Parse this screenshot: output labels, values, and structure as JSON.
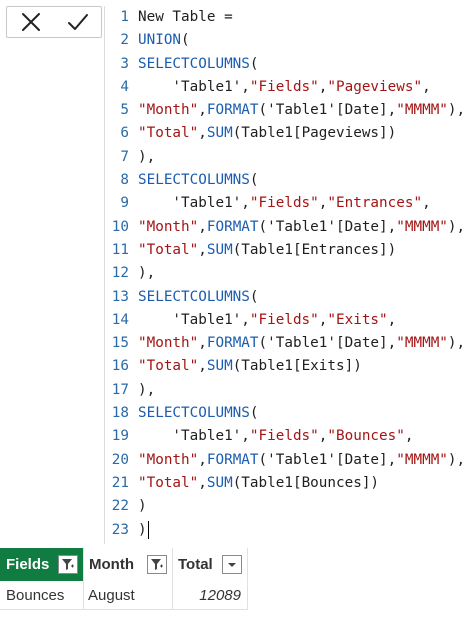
{
  "formula_bar": {
    "cancel_icon": "close-x-icon",
    "commit_icon": "checkmark-icon"
  },
  "editor": {
    "lines": [
      {
        "num": "1",
        "tokens": [
          {
            "t": "New Table = ",
            "c": "p"
          }
        ]
      },
      {
        "num": "2",
        "tokens": [
          {
            "t": "UNION",
            "c": "kw"
          },
          {
            "t": "(",
            "c": "p"
          }
        ]
      },
      {
        "num": "3",
        "tokens": [
          {
            "t": "SELECTCOLUMNS",
            "c": "kw"
          },
          {
            "t": "(",
            "c": "p"
          }
        ]
      },
      {
        "num": "4",
        "tokens": [
          {
            "t": "    'Table1'",
            "c": "p"
          },
          {
            "t": ",",
            "c": "p"
          },
          {
            "t": "\"Fields\"",
            "c": "str"
          },
          {
            "t": ",",
            "c": "p"
          },
          {
            "t": "\"Pageviews\"",
            "c": "str"
          },
          {
            "t": ",",
            "c": "p"
          }
        ]
      },
      {
        "num": "5",
        "tokens": [
          {
            "t": "\"Month\"",
            "c": "str"
          },
          {
            "t": ",",
            "c": "p"
          },
          {
            "t": "FORMAT",
            "c": "kw"
          },
          {
            "t": "('Table1'[Date],",
            "c": "p"
          },
          {
            "t": "\"MMMM\"",
            "c": "str"
          },
          {
            "t": "),",
            "c": "p"
          }
        ]
      },
      {
        "num": "6",
        "tokens": [
          {
            "t": "\"Total\"",
            "c": "str"
          },
          {
            "t": ",",
            "c": "p"
          },
          {
            "t": "SUM",
            "c": "kw"
          },
          {
            "t": "(Table1[Pageviews])",
            "c": "p"
          }
        ]
      },
      {
        "num": "7",
        "tokens": [
          {
            "t": "),",
            "c": "p"
          }
        ]
      },
      {
        "num": "8",
        "tokens": [
          {
            "t": "SELECTCOLUMNS",
            "c": "kw"
          },
          {
            "t": "(",
            "c": "p"
          }
        ]
      },
      {
        "num": "9",
        "tokens": [
          {
            "t": "    'Table1'",
            "c": "p"
          },
          {
            "t": ",",
            "c": "p"
          },
          {
            "t": "\"Fields\"",
            "c": "str"
          },
          {
            "t": ",",
            "c": "p"
          },
          {
            "t": "\"Entrances\"",
            "c": "str"
          },
          {
            "t": ",",
            "c": "p"
          }
        ]
      },
      {
        "num": "10",
        "tokens": [
          {
            "t": "\"Month\"",
            "c": "str"
          },
          {
            "t": ",",
            "c": "p"
          },
          {
            "t": "FORMAT",
            "c": "kw"
          },
          {
            "t": "('Table1'[Date],",
            "c": "p"
          },
          {
            "t": "\"MMMM\"",
            "c": "str"
          },
          {
            "t": "),",
            "c": "p"
          }
        ]
      },
      {
        "num": "11",
        "tokens": [
          {
            "t": "\"Total\"",
            "c": "str"
          },
          {
            "t": ",",
            "c": "p"
          },
          {
            "t": "SUM",
            "c": "kw"
          },
          {
            "t": "(Table1[Entrances])",
            "c": "p"
          }
        ]
      },
      {
        "num": "12",
        "tokens": [
          {
            "t": "),",
            "c": "p"
          }
        ]
      },
      {
        "num": "13",
        "tokens": [
          {
            "t": "SELECTCOLUMNS",
            "c": "kw"
          },
          {
            "t": "(",
            "c": "p"
          }
        ]
      },
      {
        "num": "14",
        "tokens": [
          {
            "t": "    'Table1'",
            "c": "p"
          },
          {
            "t": ",",
            "c": "p"
          },
          {
            "t": "\"Fields\"",
            "c": "str"
          },
          {
            "t": ",",
            "c": "p"
          },
          {
            "t": "\"Exits\"",
            "c": "str"
          },
          {
            "t": ",",
            "c": "p"
          }
        ]
      },
      {
        "num": "15",
        "tokens": [
          {
            "t": "\"Month\"",
            "c": "str"
          },
          {
            "t": ",",
            "c": "p"
          },
          {
            "t": "FORMAT",
            "c": "kw"
          },
          {
            "t": "('Table1'[Date],",
            "c": "p"
          },
          {
            "t": "\"MMMM\"",
            "c": "str"
          },
          {
            "t": "),",
            "c": "p"
          }
        ]
      },
      {
        "num": "16",
        "tokens": [
          {
            "t": "\"Total\"",
            "c": "str"
          },
          {
            "t": ",",
            "c": "p"
          },
          {
            "t": "SUM",
            "c": "kw"
          },
          {
            "t": "(Table1[Exits])",
            "c": "p"
          }
        ]
      },
      {
        "num": "17",
        "tokens": [
          {
            "t": "),",
            "c": "p"
          }
        ]
      },
      {
        "num": "18",
        "tokens": [
          {
            "t": "SELECTCOLUMNS",
            "c": "kw"
          },
          {
            "t": "(",
            "c": "p"
          }
        ]
      },
      {
        "num": "19",
        "tokens": [
          {
            "t": "    'Table1'",
            "c": "p"
          },
          {
            "t": ",",
            "c": "p"
          },
          {
            "t": "\"Fields\"",
            "c": "str"
          },
          {
            "t": ",",
            "c": "p"
          },
          {
            "t": "\"Bounces\"",
            "c": "str"
          },
          {
            "t": ",",
            "c": "p"
          }
        ]
      },
      {
        "num": "20",
        "tokens": [
          {
            "t": "\"Month\"",
            "c": "str"
          },
          {
            "t": ",",
            "c": "p"
          },
          {
            "t": "FORMAT",
            "c": "kw"
          },
          {
            "t": "('Table1'[Date],",
            "c": "p"
          },
          {
            "t": "\"MMMM\"",
            "c": "str"
          },
          {
            "t": "),",
            "c": "p"
          }
        ]
      },
      {
        "num": "21",
        "tokens": [
          {
            "t": "\"Total\"",
            "c": "str"
          },
          {
            "t": ",",
            "c": "p"
          },
          {
            "t": "SUM",
            "c": "kw"
          },
          {
            "t": "(Table1[Bounces])",
            "c": "p"
          }
        ]
      },
      {
        "num": "22",
        "tokens": [
          {
            "t": ")",
            "c": "p"
          }
        ]
      },
      {
        "num": "23",
        "tokens": [
          {
            "t": ")",
            "c": "p"
          }
        ]
      }
    ]
  },
  "table": {
    "columns": [
      {
        "label": "Fields",
        "filter_icon": "filter-applied-icon"
      },
      {
        "label": "Month",
        "filter_icon": "filter-applied-icon"
      },
      {
        "label": "Total",
        "filter_icon": "dropdown-arrow-icon"
      }
    ],
    "rows": [
      [
        "Bounces",
        "August",
        "12089"
      ]
    ]
  },
  "colors": {
    "selected_header_bg": "#107c41",
    "line_number": "#2b6aa6",
    "keyword": "#1b5cb0",
    "string": "#a31515"
  }
}
